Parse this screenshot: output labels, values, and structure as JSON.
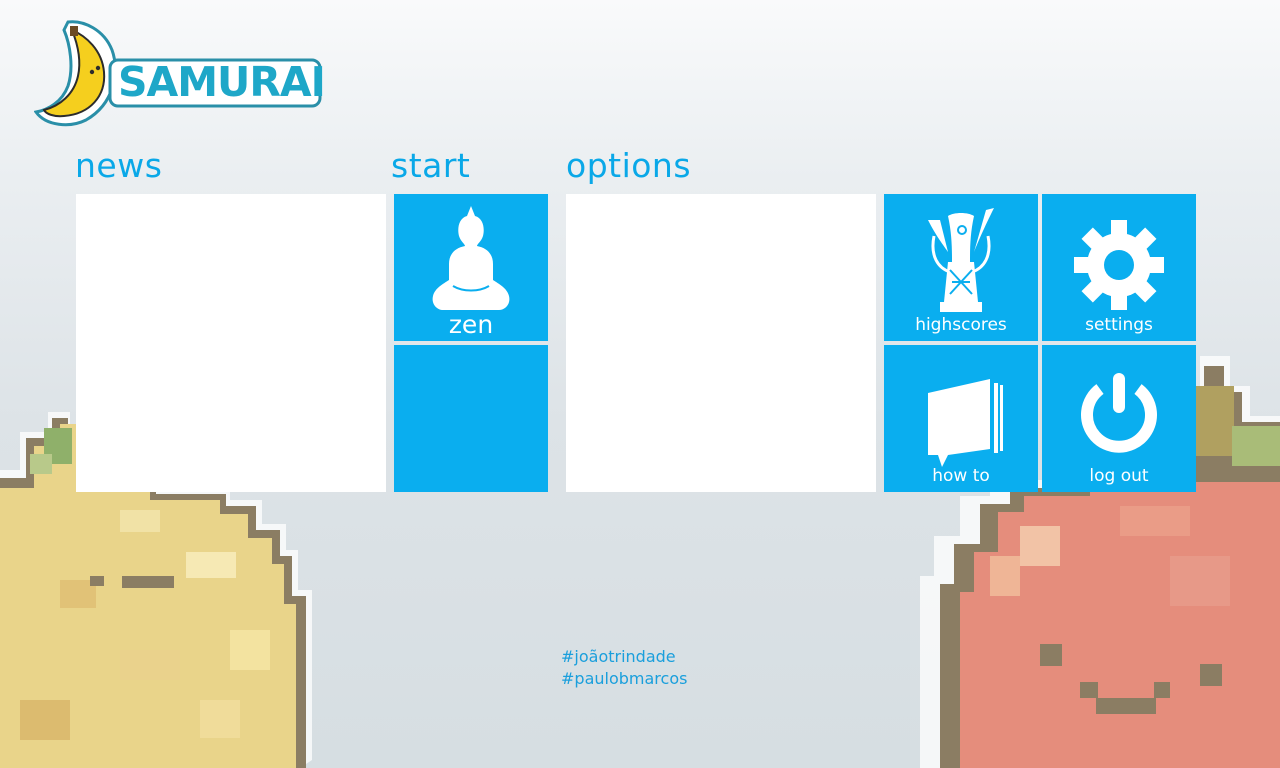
{
  "logo": {
    "text": "SAMURAI",
    "icon": "banana-icon"
  },
  "sections": {
    "news": {
      "title": "news"
    },
    "start": {
      "title": "start"
    },
    "options": {
      "title": "options"
    }
  },
  "tiles": {
    "zen": {
      "label": "zen",
      "icon": "buddha-icon"
    },
    "highscores": {
      "label": "highscores",
      "icon": "trophy-icon"
    },
    "settings": {
      "label": "settings",
      "icon": "gear-icon"
    },
    "how_to": {
      "label": "how to",
      "icon": "book-icon"
    },
    "log_out": {
      "label": "log out",
      "icon": "power-icon"
    }
  },
  "credits": [
    "#joãotrindade",
    "#paulobmarcos"
  ],
  "colors": {
    "accent": "#0aaeef",
    "title": "#0aa8e8",
    "panel": "#ffffff"
  }
}
